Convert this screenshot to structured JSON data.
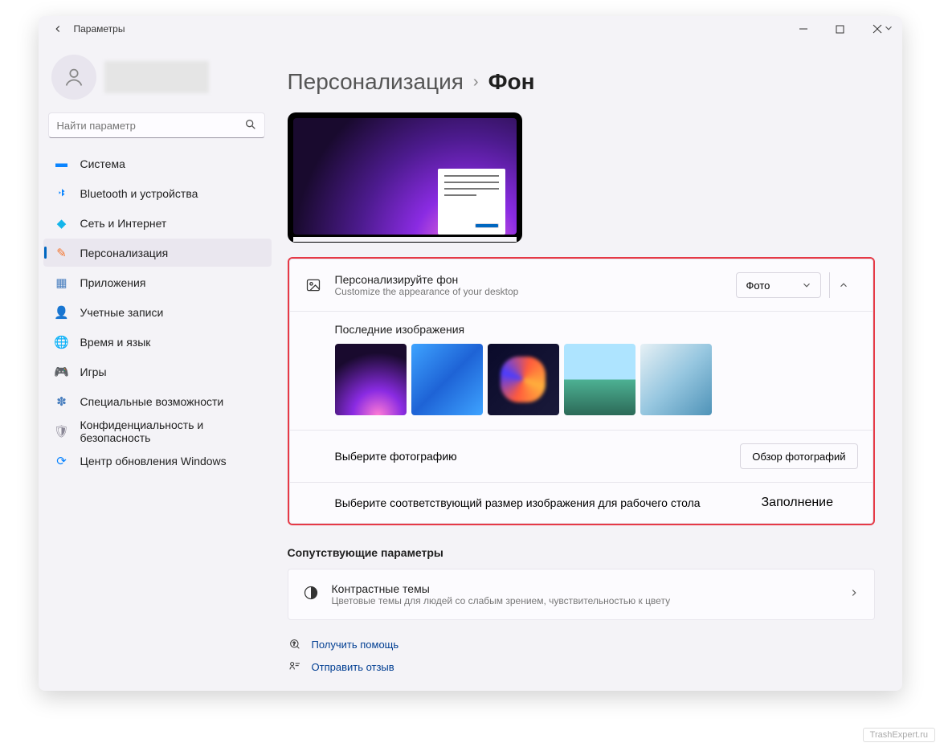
{
  "window": {
    "title": "Параметры"
  },
  "search": {
    "placeholder": "Найти параметр"
  },
  "nav": [
    {
      "icon": "🖥️",
      "label": "Система"
    },
    {
      "icon": "bt",
      "label": "Bluetooth и устройства"
    },
    {
      "icon": "📶",
      "label": "Сеть и Интернет"
    },
    {
      "icon": "🖌️",
      "label": "Персонализация",
      "active": true
    },
    {
      "icon": "🔳",
      "label": "Приложения"
    },
    {
      "icon": "👤",
      "label": "Учетные записи"
    },
    {
      "icon": "🌐",
      "label": "Время и язык"
    },
    {
      "icon": "🎮",
      "label": "Игры"
    },
    {
      "icon": "★",
      "label": "Специальные возможности"
    },
    {
      "icon": "🛡️",
      "label": "Конфиденциальность и безопасность"
    },
    {
      "icon": "🔄",
      "label": "Центр обновления Windows"
    }
  ],
  "breadcrumb": {
    "parent": "Персонализация",
    "sep": "›",
    "current": "Фон"
  },
  "bgpanel": {
    "title": "Персонализируйте фон",
    "subtitle": "Customize the appearance of your desktop",
    "dropdown": "Фото",
    "recent_title": "Последние изображения",
    "choose_photo_label": "Выберите фотографию",
    "browse_button": "Обзор фотографий",
    "fit_label": "Выберите соответствующий размер изображения для рабочего стола",
    "fit_dropdown": "Заполнение"
  },
  "related": {
    "header": "Сопутствующие параметры",
    "contrast_title": "Контрастные темы",
    "contrast_sub": "Цветовые темы для людей со слабым зрением, чувствительностью к цвету"
  },
  "links": {
    "help": "Получить помощь",
    "feedback": "Отправить отзыв"
  },
  "watermark": "TrashExpert.ru"
}
